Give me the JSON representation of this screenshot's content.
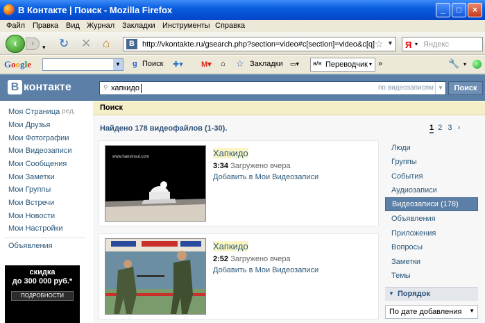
{
  "window": {
    "title": "В Контакте | Поиск - Mozilla Firefox"
  },
  "menu": [
    "Файл",
    "Правка",
    "Вид",
    "Журнал",
    "Закладки",
    "Инструменты",
    "Справка"
  ],
  "navbar": {
    "url": "http://vkontakte.ru/gsearch.php?section=video#c[section]=video&c[q]=xa",
    "yandex_placeholder": "Яндекс"
  },
  "google_toolbar": {
    "logo": "Google",
    "search": "Поиск",
    "bookmarks": "Закладки",
    "translator": "Переводчик"
  },
  "vk": {
    "logo": "контакте",
    "search_value": "хапкидо",
    "search_scope": "по видеозаписям",
    "search_button": "Поиск"
  },
  "left_nav": {
    "items": [
      "Моя Страница",
      "Мои Друзья",
      "Мои Фотографии",
      "Мои Видеозаписи",
      "Мои Сообщения",
      "Мои Заметки",
      "Мои Группы",
      "Мои Встречи",
      "Мои Новости",
      "Мои Настройки"
    ],
    "edit": "ред.",
    "ads": "Объявления"
  },
  "ad": {
    "line1": "скидка",
    "line2": "до 300 000 руб.*",
    "button": "ПОДРОБНОСТИ"
  },
  "content": {
    "breadcrumb": "Поиск",
    "found": "Найдено 178 видеофайлов (1-30).",
    "pages": [
      "1",
      "2",
      "3"
    ],
    "next": "›",
    "videos": [
      {
        "title": "Хапкидо",
        "duration": "3:34",
        "uploaded": "Загружено вчера",
        "add": "Добавить в Мои Видеозаписи",
        "thumb_caption": "www.hansinsul.com"
      },
      {
        "title": "Хапкидо",
        "duration": "2:52",
        "uploaded": "Загружено вчера",
        "add": "Добавить в Мои Видеозаписи"
      }
    ]
  },
  "right_nav": {
    "items": [
      "Люди",
      "Группы",
      "События",
      "Аудиозаписи",
      "Видеозаписи (178)",
      "Объявления",
      "Приложения",
      "Вопросы",
      "Заметки",
      "Темы"
    ],
    "selected": 4,
    "sort_header": "Порядок",
    "sort_value": "По дате добавления"
  },
  "colors": {
    "vk_blue": "#5b7fa6",
    "link": "#2b587a",
    "highlight": "#fbf5c4"
  }
}
